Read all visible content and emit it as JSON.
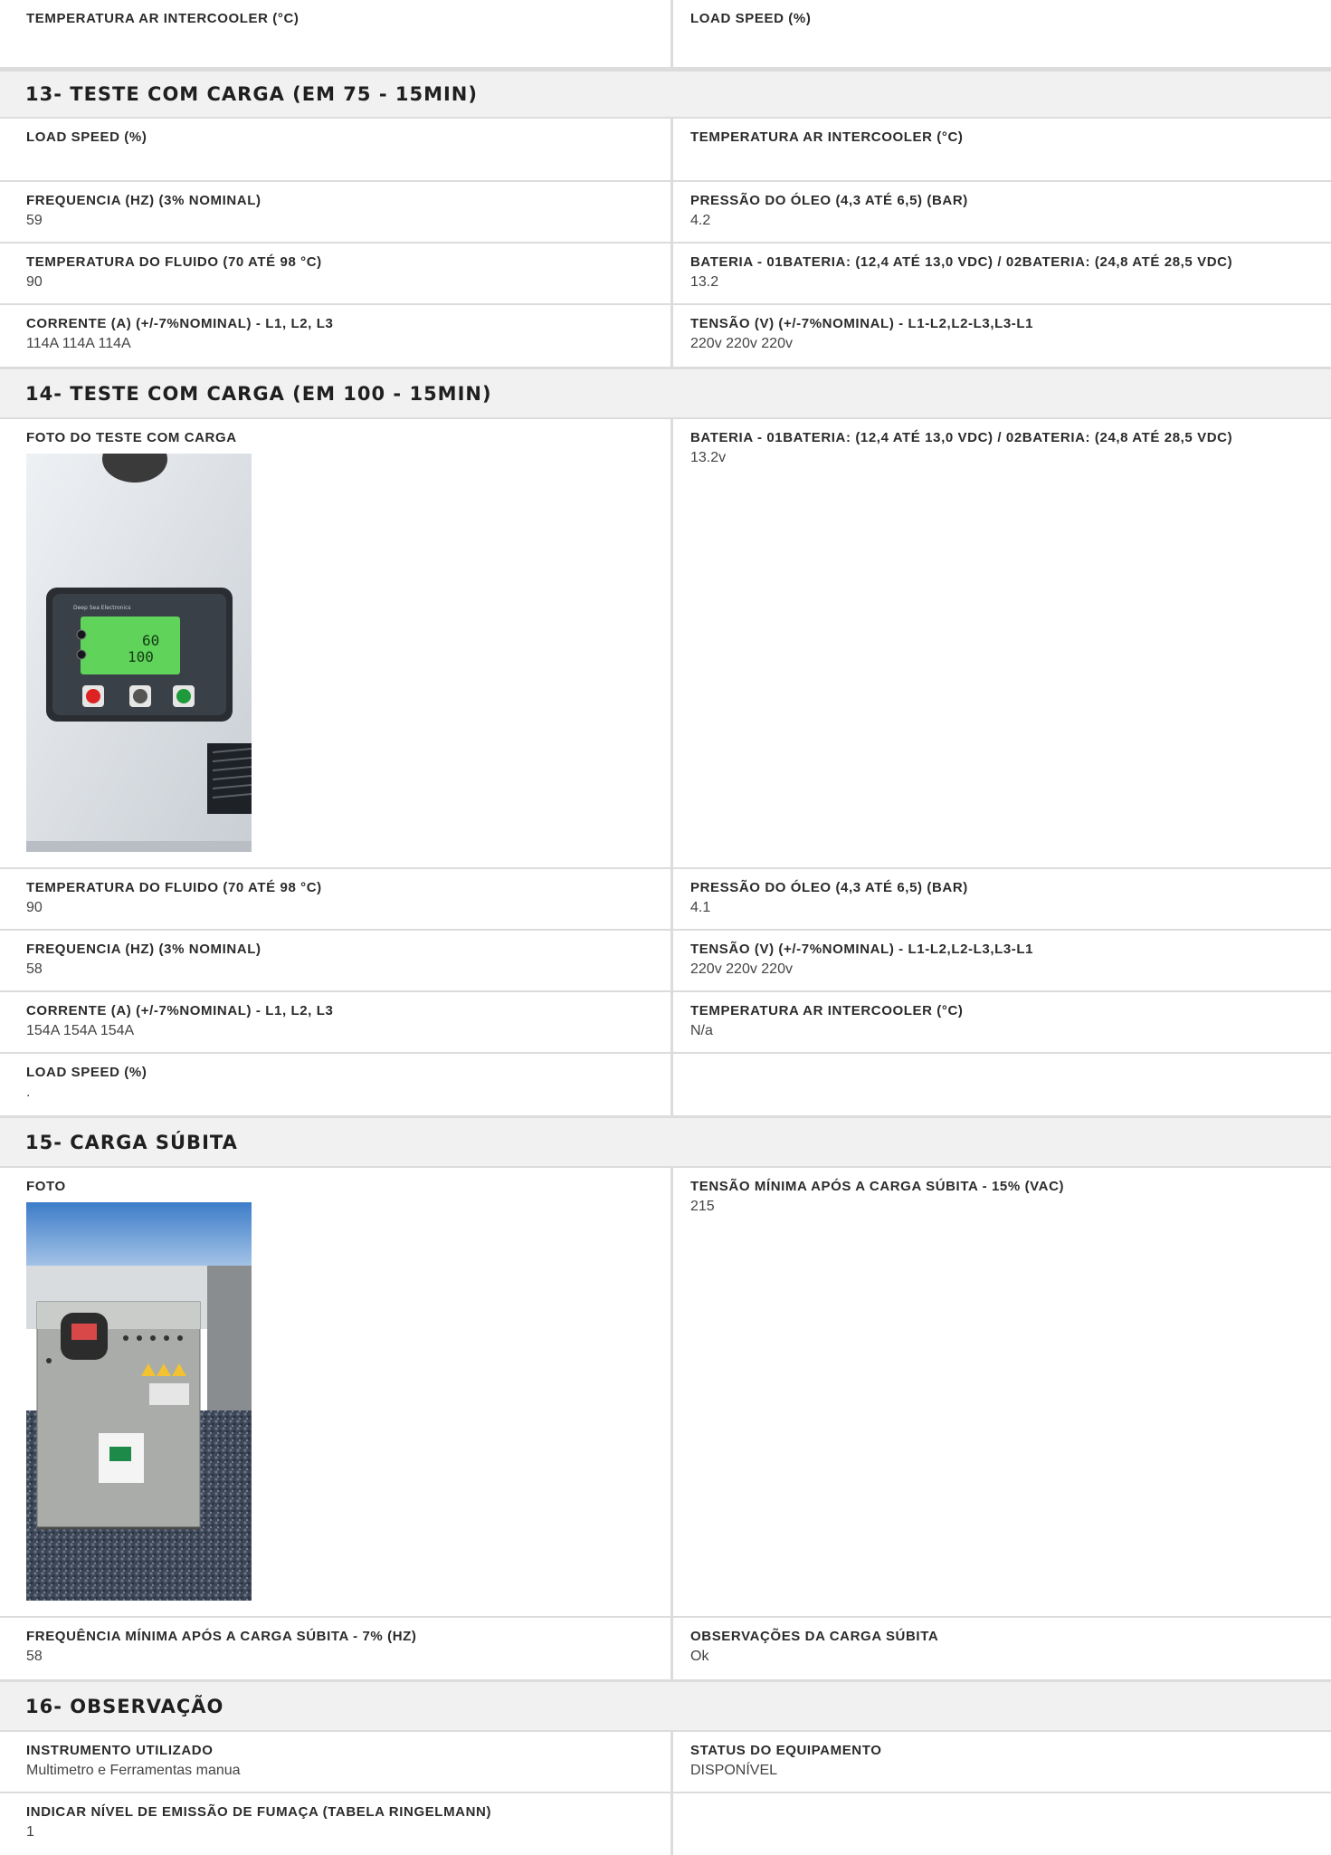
{
  "top": {
    "left_label": "TEMPERATURA AR INTERCOOLER (°C)",
    "right_label": "LOAD SPEED (%)"
  },
  "s13": {
    "title": "13- TESTE COM CARGA (EM 75 - 15MIN)",
    "rows": [
      {
        "l_label": "LOAD SPEED (%)",
        "l_value": "",
        "r_label": "TEMPERATURA AR INTERCOOLER (°C)",
        "r_value": ""
      },
      {
        "l_label": "FREQUENCIA (HZ) (3% NOMINAL)",
        "l_value": "59",
        "r_label": "PRESSÃO DO ÓLEO (4,3 ATÉ 6,5) (BAR)",
        "r_value": "4.2"
      },
      {
        "l_label": "TEMPERATURA DO FLUIDO (70 ATÉ 98 °C)",
        "l_value": "90",
        "r_label": "BATERIA - 01BATERIA: (12,4 ATÉ 13,0 VDC) / 02BATERIA: (24,8 ATÉ 28,5 VDC)",
        "r_value": "13.2"
      },
      {
        "l_label": "CORRENTE (A) (+/-7%NOMINAL) - L1, L2, L3",
        "l_value": "114A 114A 114A",
        "r_label": "TENSÃO (V) (+/-7%NOMINAL) - L1-L2,L2-L3,L3-L1",
        "r_value": "220v 220v 220v"
      }
    ]
  },
  "s14": {
    "title": "14- TESTE COM CARGA (EM 100 - 15MIN)",
    "photo_row": {
      "l_label": "FOTO DO TESTE COM CARGA",
      "r_label": "BATERIA - 01BATERIA: (12,4 ATÉ 13,0 VDC) / 02BATERIA: (24,8 ATÉ 28,5 VDC)",
      "r_value": "13.2v"
    },
    "photo_text": {
      "brand": "Deep Sea Electronics",
      "line1": "60",
      "line2": "100"
    },
    "rows": [
      {
        "l_label": "TEMPERATURA DO FLUIDO (70 ATÉ 98 °C)",
        "l_value": "90",
        "r_label": "PRESSÃO DO ÓLEO (4,3 ATÉ 6,5) (BAR)",
        "r_value": "4.1"
      },
      {
        "l_label": "FREQUENCIA (HZ) (3% NOMINAL)",
        "l_value": "58",
        "r_label": "TENSÃO (V) (+/-7%NOMINAL) - L1-L2,L2-L3,L3-L1",
        "r_value": "220v 220v 220v"
      },
      {
        "l_label": "CORRENTE (A) (+/-7%NOMINAL) - L1, L2, L3",
        "l_value": "154A 154A 154A",
        "r_label": "TEMPERATURA AR INTERCOOLER (°C)",
        "r_value": "N/a"
      },
      {
        "l_label": "LOAD SPEED (%)",
        "l_value": ".",
        "r_label": "",
        "r_value": ""
      }
    ]
  },
  "s15": {
    "title": "15- CARGA SÚBITA",
    "photo_row": {
      "l_label": "FOTO",
      "r_label": "TENSÃO MÍNIMA APÓS A CARGA SÚBITA - 15% (VAC)",
      "r_value": "215"
    },
    "rows": [
      {
        "l_label": "FREQUÊNCIA MÍNIMA APÓS A CARGA SÚBITA - 7% (HZ)",
        "l_value": "58",
        "r_label": "OBSERVAÇÕES DA CARGA SÚBITA",
        "r_value": "Ok"
      }
    ]
  },
  "s16": {
    "title": "16- OBSERVAÇÃO",
    "rows": [
      {
        "l_label": "INSTRUMENTO UTILIZADO",
        "l_value": "Multimetro e Ferramentas manua",
        "r_label": "STATUS DO EQUIPAMENTO",
        "r_value": "DISPONÍVEL"
      },
      {
        "l_label": "INDICAR NÍVEL DE EMISSÃO DE FUMAÇA (TABELA RINGELMANN)",
        "l_value": "1",
        "r_label": "",
        "r_value": ""
      }
    ]
  }
}
